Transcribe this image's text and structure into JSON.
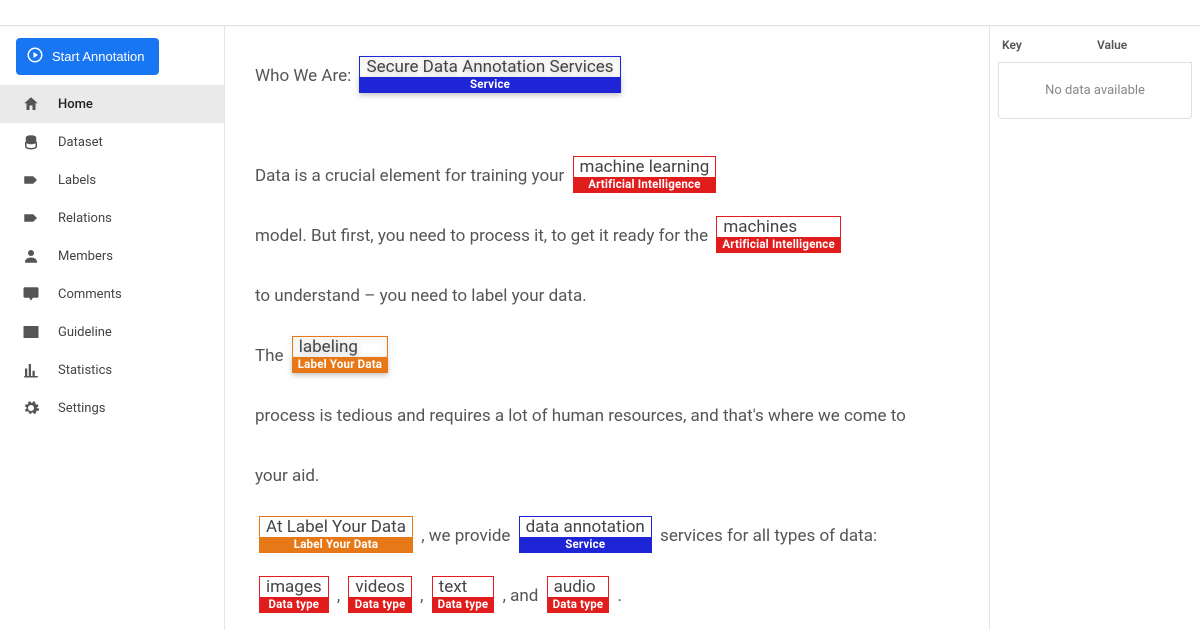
{
  "topbar": {},
  "sidebar": {
    "start_button": "Start Annotation",
    "items": [
      {
        "label": "Home",
        "icon": "home-icon",
        "active": true
      },
      {
        "label": "Dataset",
        "icon": "dataset-icon",
        "active": false
      },
      {
        "label": "Labels",
        "icon": "label-icon",
        "active": false
      },
      {
        "label": "Relations",
        "icon": "label-icon",
        "active": false
      },
      {
        "label": "Members",
        "icon": "person-icon",
        "active": false
      },
      {
        "label": "Comments",
        "icon": "comment-icon",
        "active": false
      },
      {
        "label": "Guideline",
        "icon": "book-icon",
        "active": false
      },
      {
        "label": "Statistics",
        "icon": "stats-icon",
        "active": false
      },
      {
        "label": "Settings",
        "icon": "gear-icon",
        "active": false
      }
    ]
  },
  "document": {
    "prefix_who": "Who We Are: ",
    "ann_secure": {
      "text": "Secure Data Annotation Services",
      "label": "Service",
      "color": "blue"
    },
    "line_data_crucial": "Data is a crucial element for training your ",
    "ann_ml": {
      "text": "machine learning",
      "label": "Artificial Intelligence",
      "color": "red"
    },
    "line_model": " model. But first, you need to process it, to get it ready for the ",
    "ann_machines": {
      "text": "machines",
      "label": "Artificial Intelligence",
      "color": "red"
    },
    "line_understand": " to understand – you need to label your data.",
    "line_the": "The ",
    "ann_labeling": {
      "text": "labeling",
      "label": "Label Your Data",
      "color": "orange"
    },
    "line_process": " process is tedious and requires a lot of human resources, and that's where we come to",
    "line_youraid": "your aid.",
    "ann_atlabel": {
      "text": "At Label Your Data",
      "label": "Label Your Data",
      "color": "orange"
    },
    "line_weprovide": ", we provide ",
    "ann_dataann": {
      "text": "data annotation",
      "label": "Service",
      "color": "blue"
    },
    "line_services": " services for all types of data:",
    "ann_images": {
      "text": "images",
      "label": "Data type",
      "color": "red"
    },
    "sep_comma": ", ",
    "ann_videos": {
      "text": "videos",
      "label": "Data type",
      "color": "red"
    },
    "ann_text": {
      "text": "text",
      "label": "Data type",
      "color": "red"
    },
    "sep_and": ", and ",
    "ann_audio": {
      "text": "audio",
      "label": "Data type",
      "color": "red"
    },
    "sep_period": "."
  },
  "rightpanel": {
    "key_header": "Key",
    "value_header": "Value",
    "empty_text": "No data available"
  }
}
